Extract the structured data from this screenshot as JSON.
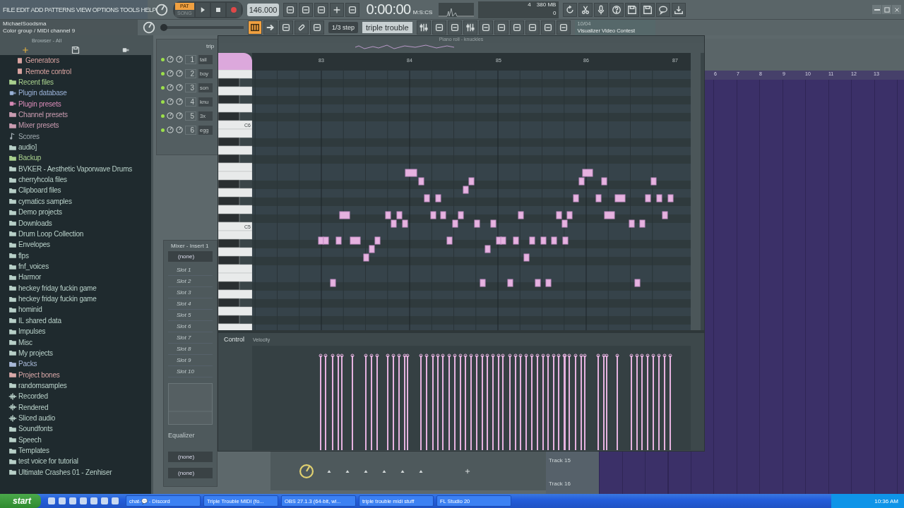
{
  "menu": [
    "FILE",
    "EDIT",
    "ADD",
    "PATTERNS",
    "VIEW",
    "OPTIONS",
    "TOOLS",
    "HELP"
  ],
  "transport": {
    "modes": [
      {
        "label": "PAT",
        "selected": true
      },
      {
        "label": "SONG",
        "selected": false
      }
    ],
    "tempo": "146.000",
    "time": "0:00:00",
    "time_unit": "M:S:CS"
  },
  "master_slider": {
    "level": 0
  },
  "hint": {
    "user": "MichaelSoodsma",
    "text": "Color group / MIDI channel 9"
  },
  "monitor": {
    "cpu": "4",
    "memory": "380 MB",
    "polyphony": "0"
  },
  "snap": "1/3 step",
  "pattern": "triple trouble",
  "news": {
    "date": "10/04",
    "title": "Visualizer Video Contest"
  },
  "browser": {
    "title": "Browser - All",
    "items": [
      {
        "name": "Generators",
        "kind": "tree-leaf",
        "color": "#d9a3a0"
      },
      {
        "name": "Remote control",
        "kind": "tree-leaf",
        "color": "#d9a3a0"
      },
      {
        "name": "Recent files",
        "kind": "folder",
        "color": "#a8d08d"
      },
      {
        "name": "Plugin database",
        "kind": "plugin",
        "color": "#9bb3d9"
      },
      {
        "name": "Plugin presets",
        "kind": "plugin",
        "color": "#d98bb8"
      },
      {
        "name": "Channel presets",
        "kind": "folder",
        "color": "#c99bb0"
      },
      {
        "name": "Mixer presets",
        "kind": "folder",
        "color": "#c99bb0"
      },
      {
        "name": "Scores",
        "kind": "note",
        "color": "#a0aab0"
      },
      {
        "name": "audio]",
        "kind": "folder",
        "color": "#b8d0c8"
      },
      {
        "name": "Backup",
        "kind": "folder",
        "color": "#a8d08d"
      },
      {
        "name": "BVKER - Aesthetic Vaporwave Drums",
        "kind": "folder",
        "color": "#b8d0c8"
      },
      {
        "name": "cherryhcola files",
        "kind": "folder",
        "color": "#b8d0c8"
      },
      {
        "name": "Clipboard files",
        "kind": "folder",
        "color": "#b8d0c8"
      },
      {
        "name": "cymatics samples",
        "kind": "folder",
        "color": "#b8d0c8"
      },
      {
        "name": "Demo projects",
        "kind": "folder",
        "color": "#b8d0c8"
      },
      {
        "name": "Downloads",
        "kind": "folder",
        "color": "#b8d0c8"
      },
      {
        "name": "Drum Loop Collection",
        "kind": "folder",
        "color": "#b8d0c8"
      },
      {
        "name": "Envelopes",
        "kind": "folder",
        "color": "#b8d0c8"
      },
      {
        "name": "flps",
        "kind": "folder",
        "color": "#b8d0c8"
      },
      {
        "name": "fnf_voices",
        "kind": "folder",
        "color": "#b8d0c8"
      },
      {
        "name": "Harmor",
        "kind": "folder",
        "color": "#b8d0c8"
      },
      {
        "name": "heckey friday fuckin game",
        "kind": "folder",
        "color": "#b8d0c8"
      },
      {
        "name": "heckey friday fuckin game",
        "kind": "folder",
        "color": "#b8d0c8"
      },
      {
        "name": "hominid",
        "kind": "folder",
        "color": "#b8d0c8"
      },
      {
        "name": "IL shared data",
        "kind": "folder",
        "color": "#b8d0c8"
      },
      {
        "name": "Impulses",
        "kind": "folder",
        "color": "#b8d0c8"
      },
      {
        "name": "Misc",
        "kind": "folder",
        "color": "#b8d0c8"
      },
      {
        "name": "My projects",
        "kind": "folder",
        "color": "#b8d0c8"
      },
      {
        "name": "Packs",
        "kind": "folder",
        "color": "#a8b8d8"
      },
      {
        "name": "Project bones",
        "kind": "folder",
        "color": "#d9a8a8"
      },
      {
        "name": "randomsamples",
        "kind": "folder",
        "color": "#b8d0c8"
      },
      {
        "name": "Recorded",
        "kind": "audio",
        "color": "#b8d0c8"
      },
      {
        "name": "Rendered",
        "kind": "audio",
        "color": "#b8d0c8"
      },
      {
        "name": "Sliced audio",
        "kind": "audio",
        "color": "#b8d0c8"
      },
      {
        "name": "Soundfonts",
        "kind": "folder",
        "color": "#b8d0c8"
      },
      {
        "name": "Speech",
        "kind": "folder",
        "color": "#b8d0c8"
      },
      {
        "name": "Templates",
        "kind": "folder",
        "color": "#b8d0c8"
      },
      {
        "name": "test voice for tutorial",
        "kind": "folder",
        "color": "#b8d0c8"
      },
      {
        "name": "Ultimate Crashes 01 - Zenhiser",
        "kind": "folder",
        "color": "#b8d0c8"
      }
    ]
  },
  "channel_rack": {
    "title": "trip",
    "channels": [
      {
        "number": "1",
        "name": "tail"
      },
      {
        "number": "2",
        "name": "boy"
      },
      {
        "number": "3",
        "name": "son"
      },
      {
        "number": "4",
        "name": "knu"
      },
      {
        "number": "5",
        "name": "3x"
      },
      {
        "number": "6",
        "name": "egg"
      }
    ]
  },
  "mixer": {
    "title": "Mixer - Insert 1",
    "input": "(none)",
    "slots": [
      "Slot 1",
      "Slot 2",
      "Slot 3",
      "Slot 4",
      "Slot 5",
      "Slot 6",
      "Slot 7",
      "Slot 8",
      "Slot 9",
      "Slot 10"
    ],
    "equalizer": "Equalizer",
    "outputs": [
      "(none)",
      "(none)"
    ]
  },
  "piano_roll": {
    "title": "Piano roll - knuckles",
    "bars": [
      "83",
      "84",
      "85",
      "86",
      "87"
    ],
    "key_labels": [
      "C6",
      "C5"
    ],
    "control": "Control",
    "parameter": "Velocity"
  },
  "playlist": {
    "bars": [
      "6",
      "7",
      "8",
      "9",
      "10",
      "11",
      "12",
      "13"
    ],
    "tracks": [
      "Track 15",
      "Track 16"
    ]
  },
  "taskbar": {
    "start": "start",
    "tasks": [
      "chat-💬 - Discord",
      "Triple Trouble MIDI (fo...",
      "OBS 27.1.3 (64-bit, wi...",
      "triple trouble midi stuff",
      "FL Studio 20"
    ],
    "clock": "10:36 AM"
  }
}
